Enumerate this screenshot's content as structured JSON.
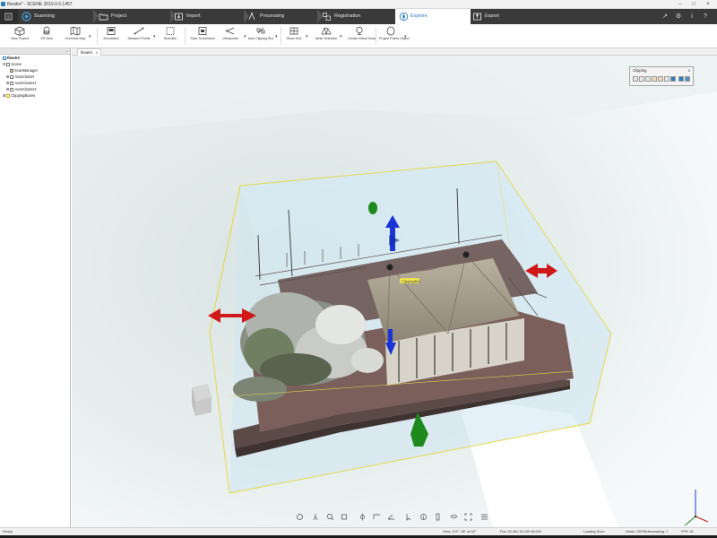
{
  "window": {
    "title": "theatre* - SCENE 2019.0.0.1457",
    "controls": [
      "minimize",
      "maximize",
      "close"
    ]
  },
  "tabs": [
    {
      "label": "Scanning",
      "icon": "scanner-icon"
    },
    {
      "label": "Project",
      "icon": "folder-icon"
    },
    {
      "label": "Import",
      "icon": "import-icon"
    },
    {
      "label": "Processing",
      "icon": "processing-icon"
    },
    {
      "label": "Registration",
      "icon": "registration-icon"
    },
    {
      "label": "Explore",
      "icon": "explore-icon",
      "active": true
    },
    {
      "label": "Export",
      "icon": "export-icon"
    }
  ],
  "ribbon": [
    {
      "label": "View Project",
      "icon": "cube-icon"
    },
    {
      "label": "VR View",
      "icon": "vr-headset-icon"
    },
    {
      "label": "Overview Map",
      "icon": "map-icon",
      "dropdown": true
    },
    {
      "label": "Annotation",
      "icon": "annotation-icon"
    },
    {
      "label": "Measure Points",
      "icon": "measure-icon",
      "dropdown": true
    },
    {
      "label": "Selection",
      "icon": "selection-icon"
    },
    {
      "label": "Save Screenshot",
      "icon": "screenshot-icon"
    },
    {
      "label": "Viewpoints",
      "icon": "viewpoints-icon",
      "dropdown": true
    },
    {
      "label": "Auto Clipping Box",
      "icon": "clipping-box-icon",
      "dropdown": true
    },
    {
      "label": "Show Grid",
      "icon": "grid-icon",
      "dropdown": true
    },
    {
      "label": "Mesh Selection",
      "icon": "mesh-icon",
      "dropdown": true
    },
    {
      "label": "Create Virtual Scan",
      "icon": "virtual-scan-icon"
    },
    {
      "label": "Project Points Object",
      "icon": "project-points-icon",
      "dropdown": true
    }
  ],
  "tree": [
    {
      "label": "theatre",
      "level": 0,
      "icon": "project-icon"
    },
    {
      "label": "Scans",
      "level": 1,
      "icon": "scans-icon"
    },
    {
      "label": "ScanManager",
      "level": 2,
      "icon": "scan-manager-icon"
    },
    {
      "label": "AutoCluster",
      "level": 2,
      "icon": "cluster-icon"
    },
    {
      "label": "AutoCluster1",
      "level": 2,
      "icon": "cluster-icon"
    },
    {
      "label": "AutoCluster2",
      "level": 2,
      "icon": "cluster-icon"
    },
    {
      "label": "ClippingBoxes",
      "level": 1,
      "icon": "clipping-folder-icon"
    }
  ],
  "viewport": {
    "tab_label": "theatre",
    "tab_close": "x",
    "box_label": "ClippingBox"
  },
  "clipping_panel": {
    "title": "Clipping",
    "close": "x",
    "buttons": [
      "clip-inside-icon",
      "clip-outside-icon",
      "clip-toggle-icon",
      "clip-reset-icon",
      "clip-hide-icon",
      "clip-show-icon",
      "clip-fit-icon",
      "clip-active-icon",
      "clip-options-icon"
    ]
  },
  "bottom_toolbar": [
    "rotate-icon",
    "walk-icon",
    "zoom-icon",
    "view-cube-icon",
    "center-icon",
    "measure-distance-icon",
    "measure-angle-icon",
    "select-icon",
    "info-icon",
    "ruler-icon",
    "layers-icon",
    "fullscreen-icon",
    "menu-icon"
  ],
  "status": {
    "state": "Ready",
    "view": "View: 223° -35° at 54°",
    "position": "Pos: 62.464 33.039 48.628",
    "loading": "Loading Done",
    "detail": "Detail: 100%",
    "subsampling": "Subsampling: 1",
    "fps": "FPS: 30"
  },
  "colors": {
    "tab_bar": "#3a3a3a",
    "accent": "#2a7fc1",
    "clipping_box_edge": "#e6d84a",
    "clipping_box_fill": "#cfe6f2",
    "arrow_x": "#d01818",
    "arrow_y": "#1a34d6",
    "arrow_z": "#1e8a1e"
  }
}
